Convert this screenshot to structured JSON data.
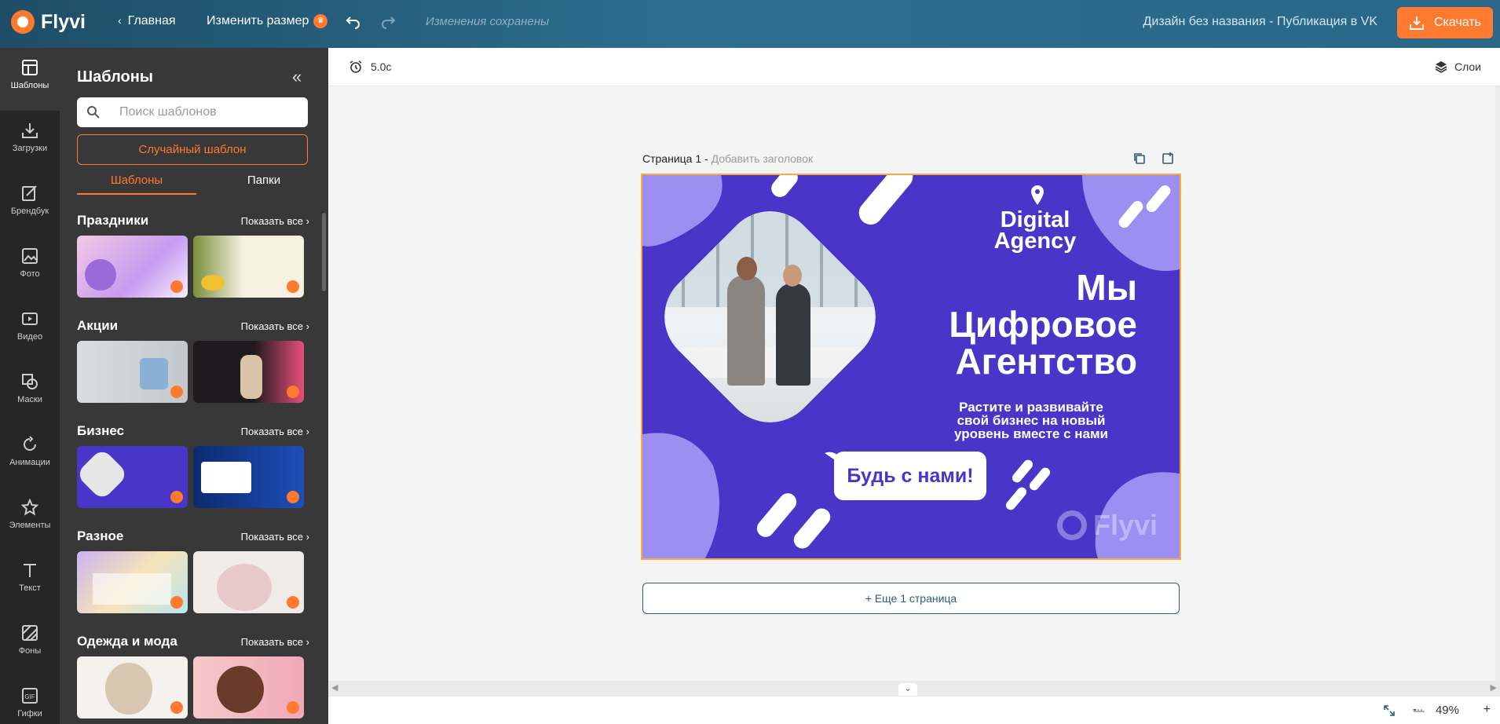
{
  "topbar": {
    "logo_text": "Flyvi",
    "home_label": "Главная",
    "resize_label": "Изменить размер",
    "saved_status": "Изменения сохранены",
    "design_title": "Дизайн без названия - Публикация в VK",
    "download_label": "Скачать"
  },
  "rail": {
    "items": [
      {
        "label": "Шаблоны",
        "icon": "layout-icon"
      },
      {
        "label": "Загрузки",
        "icon": "upload-icon"
      },
      {
        "label": "Брендбук",
        "icon": "brandbook-icon"
      },
      {
        "label": "Фото",
        "icon": "image-icon"
      },
      {
        "label": "Видео",
        "icon": "video-icon"
      },
      {
        "label": "Маски",
        "icon": "mask-icon"
      },
      {
        "label": "Анимации",
        "icon": "animation-icon"
      },
      {
        "label": "Элементы",
        "icon": "star-icon"
      },
      {
        "label": "Текст",
        "icon": "text-icon"
      },
      {
        "label": "Фоны",
        "icon": "background-icon"
      },
      {
        "label": "Гифки",
        "icon": "gif-icon"
      }
    ]
  },
  "panel": {
    "title": "Шаблоны",
    "search_placeholder": "Поиск шаблонов",
    "random_label": "Случайный шаблон",
    "tab_templates": "Шаблоны",
    "tab_folders": "Папки",
    "show_all": "Показать все",
    "categories": [
      {
        "name": "Праздники"
      },
      {
        "name": "Акции"
      },
      {
        "name": "Бизнес"
      },
      {
        "name": "Разное"
      },
      {
        "name": "Одежда и мода"
      }
    ]
  },
  "canvas": {
    "duration": "5.0с",
    "layers_label": "Слои",
    "page_label": "Страница 1 -",
    "page_title_placeholder": "Добавить заголовок",
    "add_page": "+ Еще 1 страница",
    "zoom": "49%",
    "zoom_minus": "-",
    "zoom_plus": "+"
  },
  "design": {
    "brand_line1": "Digital",
    "brand_line2": "Agency",
    "headline1": "Мы",
    "headline2": "Цифровое",
    "headline3": "Агентство",
    "sub1": "Растите и развивайте",
    "sub2": "свой бизнес на новый",
    "sub3": "уровень вместе с нами",
    "cta": "Будь с нами!",
    "watermark": "Flyvi"
  },
  "colors": {
    "accent": "#ff7a2f",
    "design_purple": "#4a35c9",
    "design_light_purple": "#9b8ff2",
    "topbar": "#2c6e8f"
  }
}
